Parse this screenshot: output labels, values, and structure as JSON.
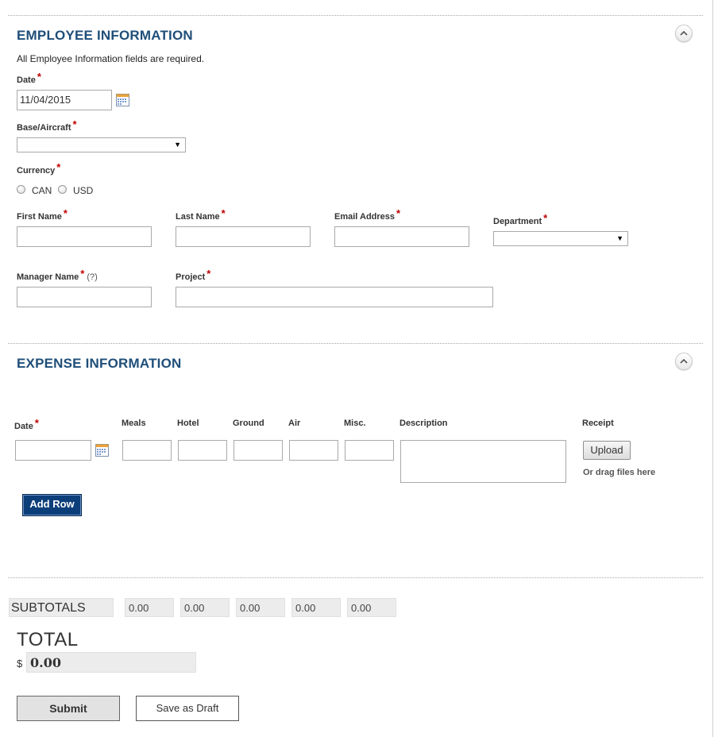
{
  "employee": {
    "title": "EMPLOYEE INFORMATION",
    "note": "All Employee Information fields are required.",
    "date_label": "Date",
    "date_value": "11/04/2015",
    "base_label": "Base/Aircraft",
    "base_value": "",
    "currency_label": "Currency",
    "currency_options": [
      "CAN",
      "USD"
    ],
    "first_name_label": "First Name",
    "last_name_label": "Last Name",
    "email_label": "Email Address",
    "department_label": "Department",
    "department_value": "",
    "manager_label": "Manager Name",
    "manager_hint": "(?)",
    "project_label": "Project"
  },
  "expense": {
    "title": "EXPENSE INFORMATION",
    "columns": [
      "Date",
      "Meals",
      "Hotel",
      "Ground",
      "Air",
      "Misc.",
      "Description",
      "Receipt"
    ],
    "upload_label": "Upload",
    "drag_note": "Or drag files here",
    "add_row_label": "Add Row"
  },
  "subtotals": {
    "label": "SUBTOTALS",
    "values": [
      "0.00",
      "0.00",
      "0.00",
      "0.00",
      "0.00"
    ]
  },
  "total": {
    "title": "TOTAL",
    "currency_symbol": "$",
    "value": "0.00"
  },
  "actions": {
    "submit_label": "Submit",
    "draft_label": "Save as Draft"
  },
  "required_marker": "*",
  "colors": {
    "section_title": "#1f4e79",
    "required": "#c00000",
    "add_row_bg": "#0c3e7a"
  }
}
